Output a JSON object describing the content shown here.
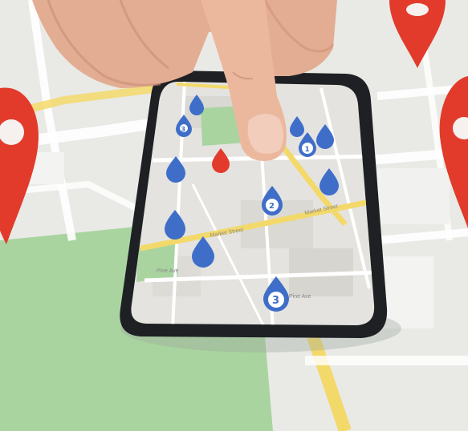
{
  "scene": {
    "description_free": true,
    "colors": {
      "map_background": "#e9eae6",
      "park_green": "#a9d4a0",
      "road_yellow": "#f3d96a",
      "road_white": "#ffffff",
      "phone_body": "#1e2024",
      "pin_blue": "#3f6ec9",
      "pin_red": "#e23b2b",
      "skin": "#e8b49a"
    }
  },
  "phone_map": {
    "street_labels": [
      "Market Street",
      "Market Street",
      "Pine Ave",
      "Pine Ave"
    ],
    "pin_numbers": [
      "1",
      "2",
      "3",
      "3"
    ]
  },
  "icons": {
    "large_pin": "map-marker-icon",
    "small_pin": "drop-pin-icon"
  }
}
